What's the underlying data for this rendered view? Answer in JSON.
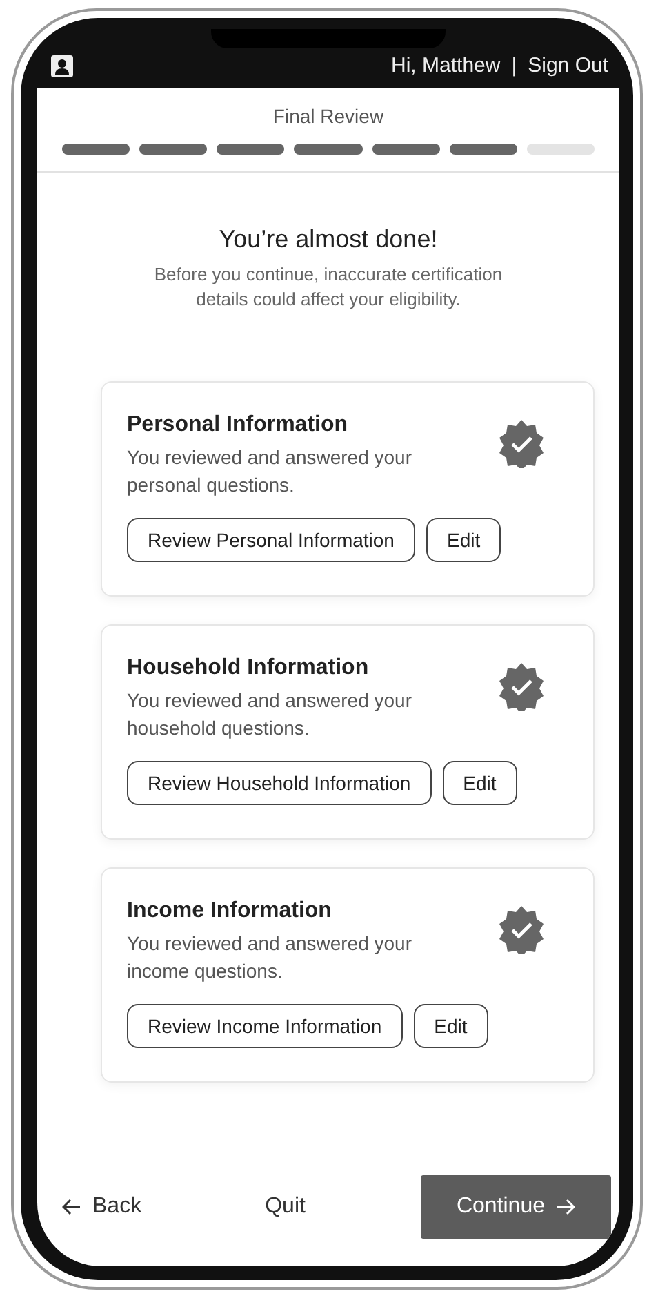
{
  "header": {
    "greeting": "Hi, Matthew",
    "separator": "|",
    "sign_out": "Sign Out"
  },
  "step": {
    "title": "Final Review",
    "steps": [
      {
        "completed": true
      },
      {
        "completed": true
      },
      {
        "completed": true
      },
      {
        "completed": true
      },
      {
        "completed": true
      },
      {
        "completed": true
      },
      {
        "completed": false
      }
    ]
  },
  "intro": {
    "heading": "You’re almost done!",
    "text": "Before you continue, inaccurate certification details could affect your eligibility."
  },
  "sections": [
    {
      "title": "Personal Information",
      "text": "You reviewed and answered your personal questions.",
      "verified": true,
      "review_button": "Review Personal Information",
      "edit_button": "Edit"
    },
    {
      "title": "Household Information",
      "text": "You reviewed and answered your household questions.",
      "verified": true,
      "review_button": "Review Household Information",
      "edit_button": "Edit"
    },
    {
      "title": "Income Information",
      "text": "You reviewed and answered your income questions.",
      "verified": true,
      "review_button": "Review Income Information",
      "edit_button": "Edit"
    }
  ],
  "footer": {
    "back": "Back",
    "quit": "Quit",
    "continue": "Continue"
  }
}
